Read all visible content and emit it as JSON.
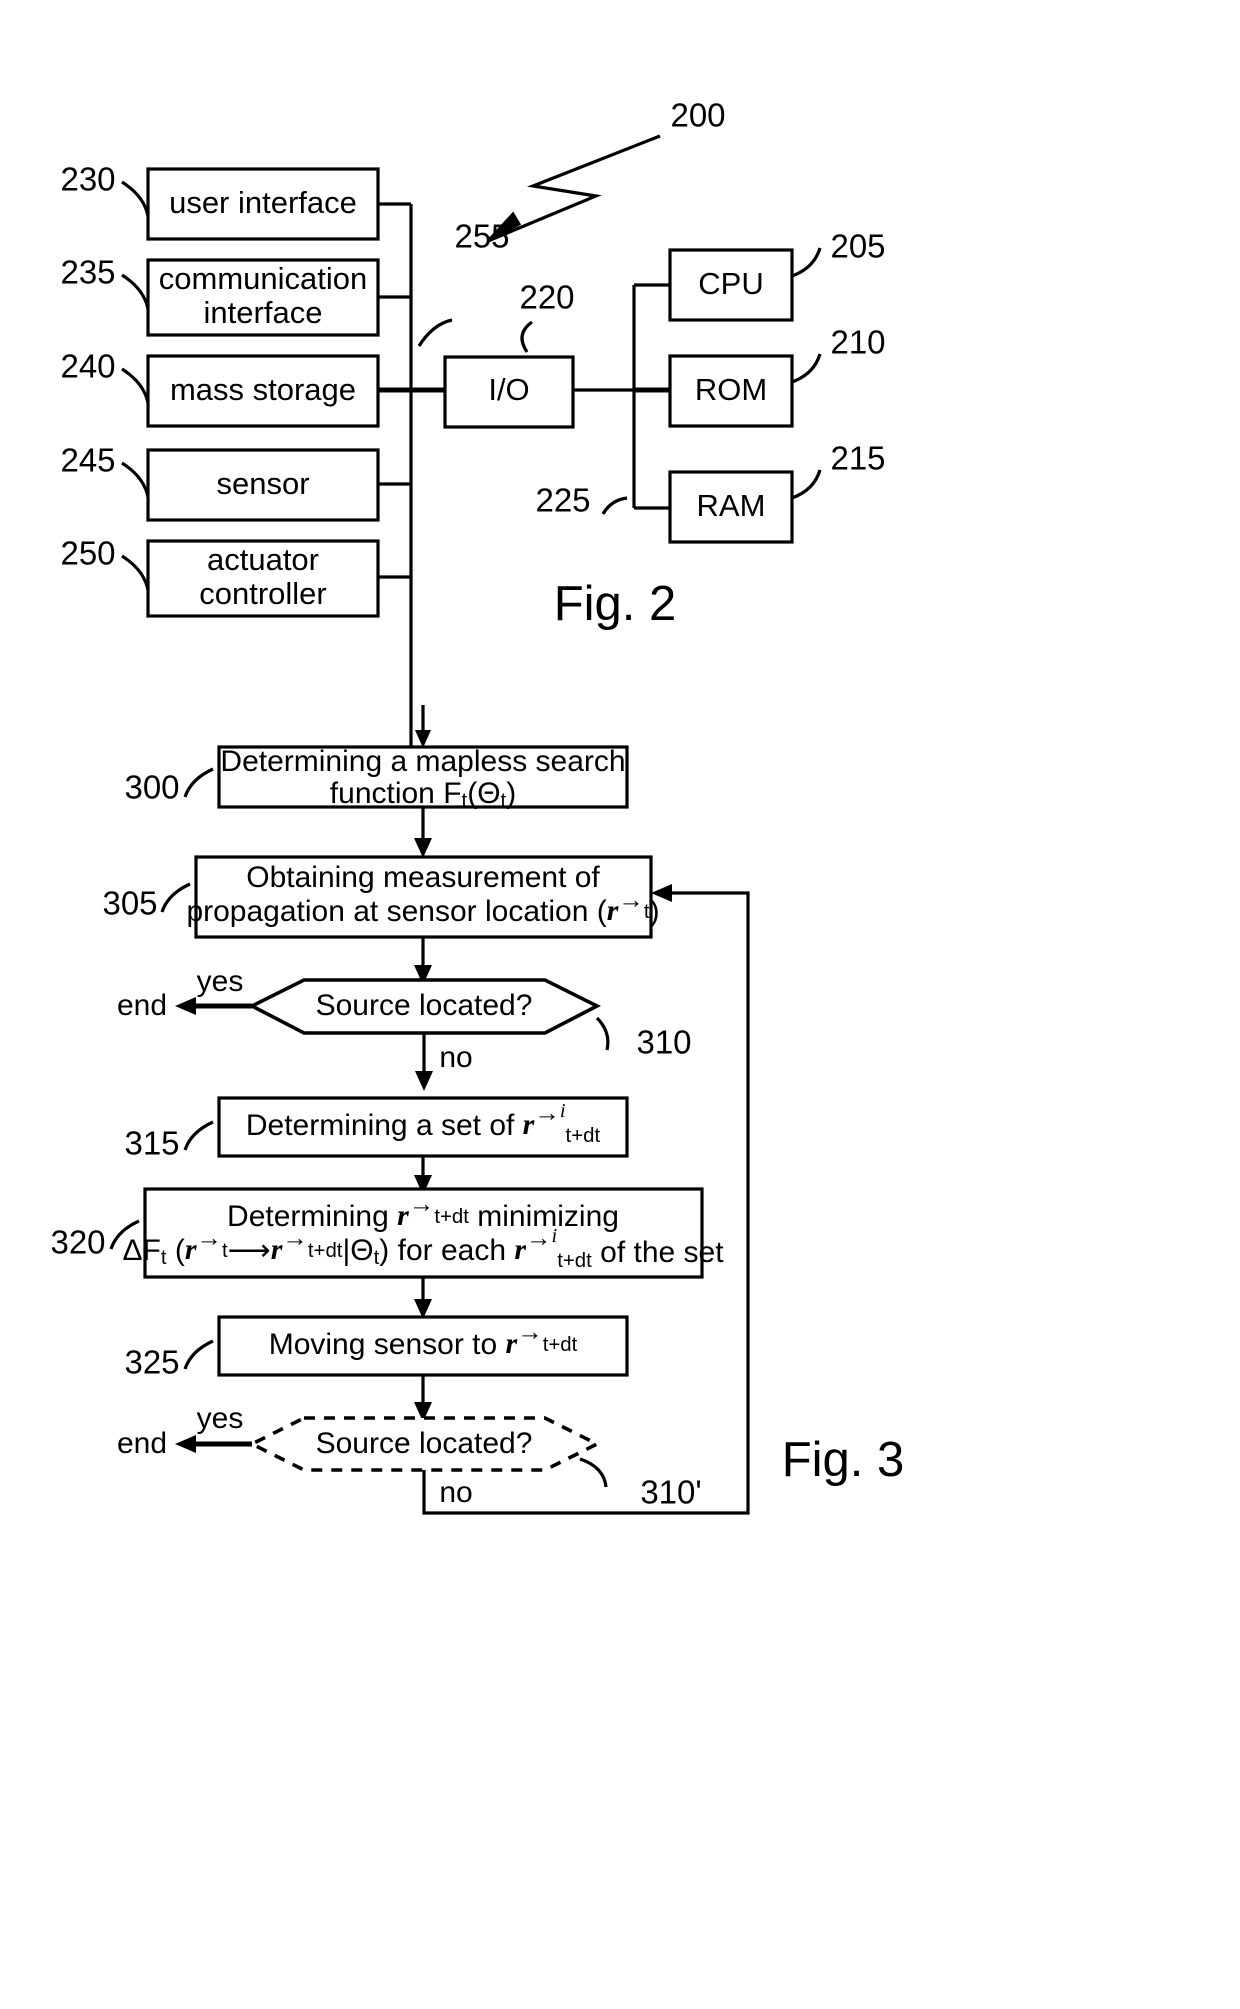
{
  "figures": [
    {
      "id": "fig2",
      "caption": "Fig. 2",
      "system_ref": "200",
      "bus_ref_left": "255",
      "bus_ref_right": "225",
      "left_blocks": [
        {
          "ref": "230",
          "label": "user interface"
        },
        {
          "ref": "235",
          "label_line1": "communication",
          "label_line2": "interface"
        },
        {
          "ref": "240",
          "label": "mass storage"
        },
        {
          "ref": "245",
          "label": "sensor"
        },
        {
          "ref": "250",
          "label_line1": "actuator",
          "label_line2": "controller"
        }
      ],
      "center_block": {
        "ref": "220",
        "label": "I/O"
      },
      "right_blocks": [
        {
          "ref": "205",
          "label": "CPU"
        },
        {
          "ref": "210",
          "label": "ROM"
        },
        {
          "ref": "215",
          "label": "RAM"
        }
      ]
    },
    {
      "id": "fig3",
      "caption": "Fig. 3",
      "steps": [
        {
          "ref": "300",
          "line1": "Determining a mapless search",
          "line2_pre": "function F",
          "line2_sub1": "t",
          "line2_mid": "(Θ",
          "line2_sub2": "t",
          "line2_post": ")"
        },
        {
          "ref": "305",
          "line1": "Obtaining measurement of",
          "line2_pre": "propagation at sensor location (",
          "line2_vec": "r",
          "line2_sub": "t",
          "line2_post": ")"
        },
        {
          "ref": "310",
          "type": "decision",
          "label": "Source located?",
          "yes": "yes",
          "no": "no",
          "end": "end"
        },
        {
          "ref": "315",
          "line1_pre": "Determining a set of ",
          "line1_vec": "r",
          "line1_sup": "i",
          "line1_sub": "t+dt"
        },
        {
          "ref": "320",
          "line1_pre": "Determining ",
          "line1_vec": "r",
          "line1_sub": "t+dt",
          "line1_post": " minimizing",
          "line2_a": "ΔF",
          "line2_a_sub": "t",
          "line2_b": " (",
          "line2_v1": "r",
          "line2_v1_sub": "t",
          "line2_arrow": "⟶",
          "line2_v2": "r",
          "line2_v2_sub": "t+dt",
          "line2_c": "|Θ",
          "line2_c_sub": "t",
          "line2_d": ") for each ",
          "line2_v3": "r",
          "line2_v3_sup": "i",
          "line2_v3_sub": "t+dt",
          "line2_e": " of the set"
        },
        {
          "ref": "325",
          "line1_pre": "Moving sensor to ",
          "line1_vec": "r",
          "line1_sub": "t+dt"
        },
        {
          "ref": "310'",
          "type": "decision-dashed",
          "label": "Source located?",
          "yes": "yes",
          "no": "no",
          "end": "end"
        }
      ]
    }
  ]
}
